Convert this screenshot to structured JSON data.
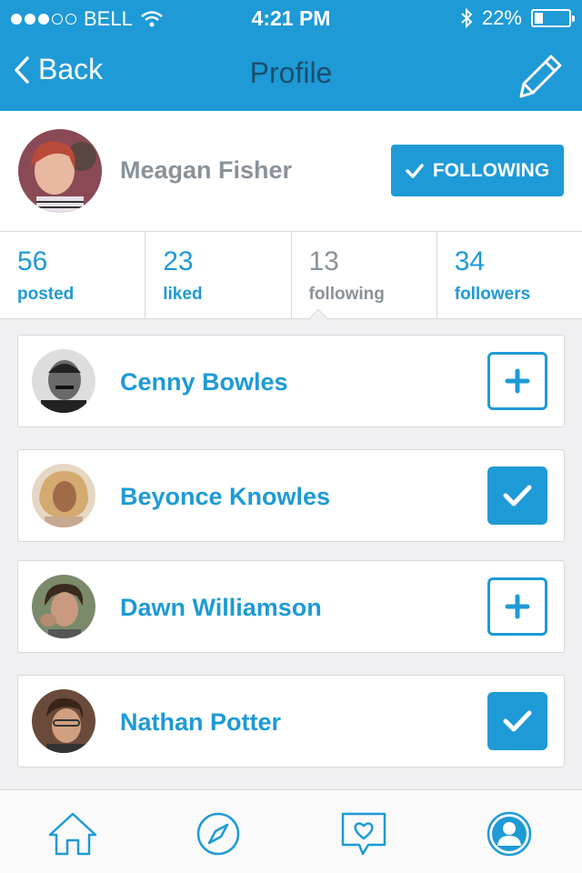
{
  "status": {
    "carrier": "BELL",
    "time": "4:21 PM",
    "battery": "22%"
  },
  "nav": {
    "back_label": "Back",
    "title": "Profile"
  },
  "profile": {
    "name": "Meagan Fisher",
    "follow_label": "FOLLOWING"
  },
  "stats": [
    {
      "value": "56",
      "label": "posted"
    },
    {
      "value": "23",
      "label": "liked"
    },
    {
      "value": "13",
      "label": "following"
    },
    {
      "value": "34",
      "label": "followers"
    }
  ],
  "users": [
    {
      "name": "Cenny Bowles",
      "followed": false
    },
    {
      "name": "Beyonce Knowles",
      "followed": true
    },
    {
      "name": "Dawn Williamson",
      "followed": false
    },
    {
      "name": "Nathan Potter",
      "followed": true
    }
  ],
  "colors": {
    "accent": "#1e9ad6",
    "title": "#1a4f6e",
    "muted": "#8a9299",
    "background": "#f0f0f2"
  },
  "icons": {
    "tabs": [
      "home-icon",
      "compass-icon",
      "heart-message-icon",
      "user-profile-icon"
    ]
  }
}
